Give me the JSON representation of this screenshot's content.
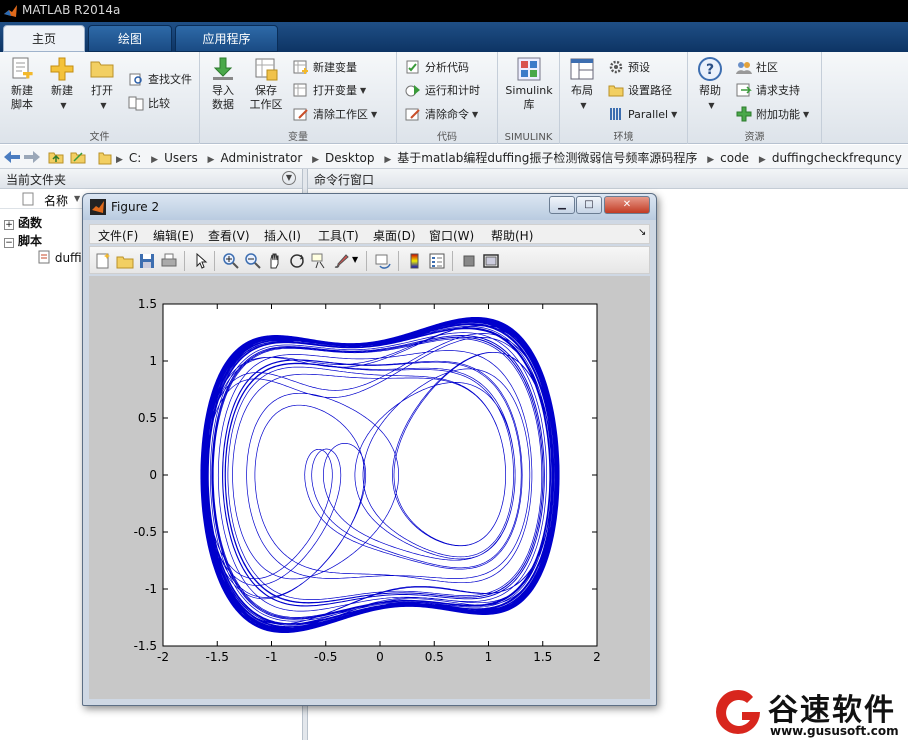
{
  "window": {
    "title": "MATLAB R2014a"
  },
  "ribbon_tabs": [
    {
      "label": "主页",
      "active": true
    },
    {
      "label": "绘图",
      "active": false
    },
    {
      "label": "应用程序",
      "active": false
    }
  ],
  "ribbon": {
    "file": {
      "label": "文件",
      "new_script": [
        "新建",
        "脚本"
      ],
      "new": "新建",
      "open": "打开",
      "find_files": "查找文件",
      "compare": "比较"
    },
    "variable": {
      "label": "变量",
      "import": [
        "导入",
        "数据"
      ],
      "save": [
        "保存",
        "工作区"
      ],
      "new_var": "新建变量",
      "open_var": "打开变量",
      "clear_ws": "清除工作区"
    },
    "code": {
      "label": "代码",
      "analyze": "分析代码",
      "run_time": "运行和计时",
      "clear_cmd": "清除命令"
    },
    "simulink": {
      "label": "SIMULINK",
      "lib": [
        "Simulink",
        "库"
      ]
    },
    "env": {
      "label": "环境",
      "layout": "布局",
      "prefs": "预设",
      "set_path": "设置路径",
      "parallel": "Parallel"
    },
    "resources": {
      "label": "资源",
      "help": "帮助",
      "community": "社区",
      "support": "请求支持",
      "addons": "附加功能"
    }
  },
  "address": {
    "segments": [
      "C:",
      "Users",
      "Administrator",
      "Desktop",
      "基于matlab编程duffing振子检测微弱信号频率源码程序",
      "code",
      "duffingcheckfrequncy"
    ]
  },
  "current_folder": {
    "title": "当前文件夹",
    "col_name": "名称",
    "groups": [
      "函数",
      "脚本"
    ],
    "file": "duffi"
  },
  "command_window": {
    "title": "命令行窗口"
  },
  "figure": {
    "title": "Figure 2",
    "menu": [
      "文件(F)",
      "编辑(E)",
      "查看(V)",
      "插入(I)",
      "工具(T)",
      "桌面(D)",
      "窗口(W)",
      "帮助(H)"
    ]
  },
  "chart_data": {
    "type": "line",
    "title": "",
    "xlabel": "",
    "ylabel": "",
    "xlim": [
      -2,
      2
    ],
    "ylim": [
      -1.5,
      1.5
    ],
    "xticks": [
      "-2",
      "-1.5",
      "-1",
      "-0.5",
      "0",
      "0.5",
      "1",
      "1.5",
      "2"
    ],
    "yticks": [
      "1.5",
      "1",
      "0.5",
      "0",
      "-0.5",
      "-1",
      "-1.5"
    ],
    "grid": false,
    "series_color": "#0000cc",
    "series": [
      {
        "name": "",
        "model": "duffing",
        "params": {
          "k": 0.5,
          "a": -1,
          "b": 1,
          "gamma": 0.826,
          "omega": 1
        },
        "x0": [
          0.1,
          0
        ],
        "t_end": 500,
        "dt": 0.01,
        "transient": 20
      }
    ]
  },
  "watermark": {
    "brand": "谷速软件",
    "url": "www.gususoft.com"
  }
}
